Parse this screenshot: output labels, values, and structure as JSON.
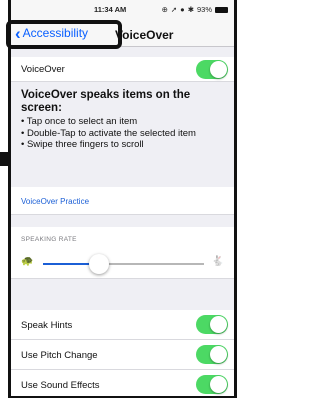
{
  "status": {
    "carrier": "",
    "time": "11:34 AM",
    "battery": "93%"
  },
  "nav": {
    "back_label": "Accessibility",
    "title": "VoiceOver"
  },
  "voiceover": {
    "label": "VoiceOver",
    "enabled": true
  },
  "description": {
    "heading": "VoiceOver speaks items on the screen:",
    "bullets": [
      "• Tap once to select an item",
      "• Double-Tap to activate the selected item",
      "• Swipe three fingers to scroll"
    ]
  },
  "practice_link": "VoiceOver Practice",
  "speaking_rate": {
    "section_label": "SPEAKING RATE",
    "value": 0.35
  },
  "toggles": [
    {
      "label": "Speak Hints",
      "enabled": true
    },
    {
      "label": "Use Pitch Change",
      "enabled": true
    },
    {
      "label": "Use Sound Effects",
      "enabled": true
    }
  ],
  "colors": {
    "accent": "#1b5fd6",
    "switch_on": "#4cd964"
  }
}
